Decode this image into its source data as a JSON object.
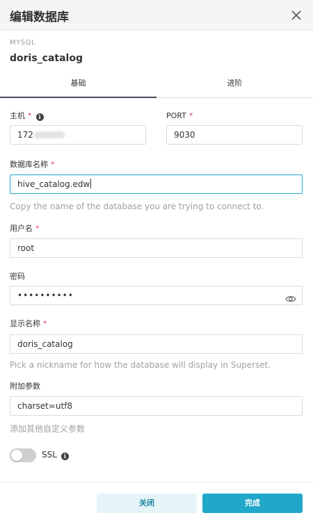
{
  "modal": {
    "title": "编辑数据库",
    "db_type": "MYSQL",
    "db_name": "doris_catalog"
  },
  "tabs": [
    {
      "label": "基础",
      "active": true
    },
    {
      "label": "进阶",
      "active": false
    }
  ],
  "form": {
    "host": {
      "label": "主机",
      "value": "172"
    },
    "port": {
      "label": "PORT",
      "value": "9030"
    },
    "database_name": {
      "label": "数据库名称",
      "value": "hive_catalog.edw",
      "hint": "Copy the name of the database you are trying to connect to."
    },
    "username": {
      "label": "用户名",
      "value": "root"
    },
    "password": {
      "label": "密码",
      "value": "••••••••••"
    },
    "display_name": {
      "label": "显示名称",
      "value": "doris_catalog",
      "hint": "Pick a nickname for how the database will display in Superset."
    },
    "extra_params": {
      "label": "附加参数",
      "value": "charset=utf8",
      "hint": "添加其他自定义参数"
    },
    "ssl": {
      "label": "SSL",
      "enabled": false
    }
  },
  "footer": {
    "close_label": "关闭",
    "finish_label": "完成"
  },
  "colors": {
    "accent": "#20a7c9",
    "required": "#e04355"
  }
}
